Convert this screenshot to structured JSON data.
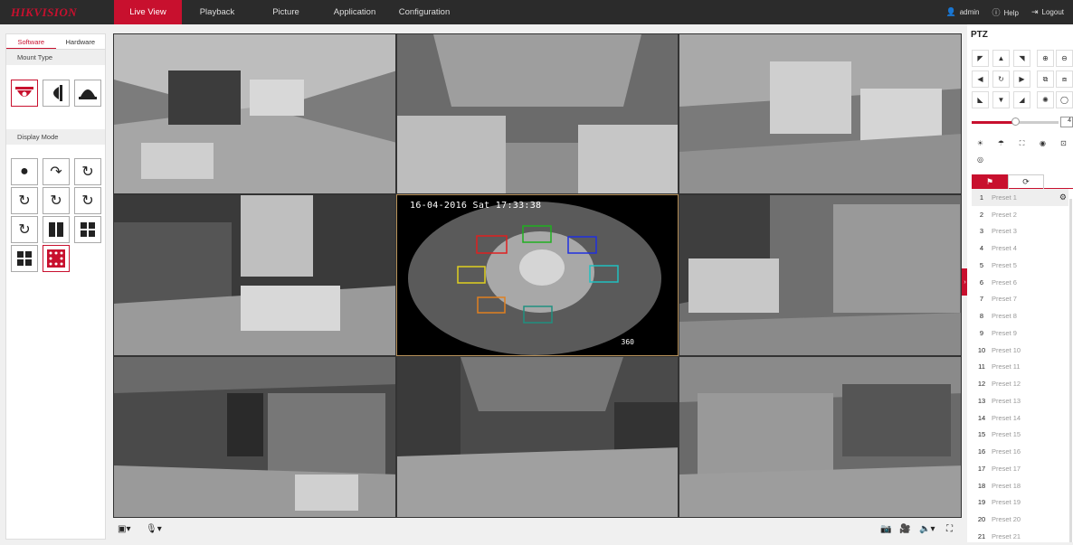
{
  "header": {
    "logo": "HIKVISION",
    "nav": [
      "Live View",
      "Playback",
      "Picture",
      "Application",
      "Configuration"
    ],
    "user": "admin",
    "help": "Help",
    "logout": "Logout"
  },
  "left": {
    "tabs": [
      "Software",
      "Hardware"
    ],
    "mount_type": "Mount Type",
    "display_mode": "Display Mode"
  },
  "video": {
    "timestamp": "16-04-2016 Sat 17:33:38",
    "degree_label": "360"
  },
  "ptz": {
    "title": "PTZ",
    "zoom_value": "4",
    "presets": [
      {
        "num": "1",
        "label": "Preset 1"
      },
      {
        "num": "2",
        "label": "Preset 2"
      },
      {
        "num": "3",
        "label": "Preset 3"
      },
      {
        "num": "4",
        "label": "Preset 4"
      },
      {
        "num": "5",
        "label": "Preset 5"
      },
      {
        "num": "6",
        "label": "Preset 6"
      },
      {
        "num": "7",
        "label": "Preset 7"
      },
      {
        "num": "8",
        "label": "Preset 8"
      },
      {
        "num": "9",
        "label": "Preset 9"
      },
      {
        "num": "10",
        "label": "Preset 10"
      },
      {
        "num": "11",
        "label": "Preset 11"
      },
      {
        "num": "12",
        "label": "Preset 12"
      },
      {
        "num": "13",
        "label": "Preset 13"
      },
      {
        "num": "14",
        "label": "Preset 14"
      },
      {
        "num": "15",
        "label": "Preset 15"
      },
      {
        "num": "16",
        "label": "Preset 16"
      },
      {
        "num": "17",
        "label": "Preset 17"
      },
      {
        "num": "18",
        "label": "Preset 18"
      },
      {
        "num": "19",
        "label": "Preset 19"
      },
      {
        "num": "20",
        "label": "Preset 20"
      },
      {
        "num": "21",
        "label": "Preset 21"
      }
    ]
  },
  "colors": {
    "brand": "#c8102e",
    "topbar": "#2b2b2b"
  }
}
